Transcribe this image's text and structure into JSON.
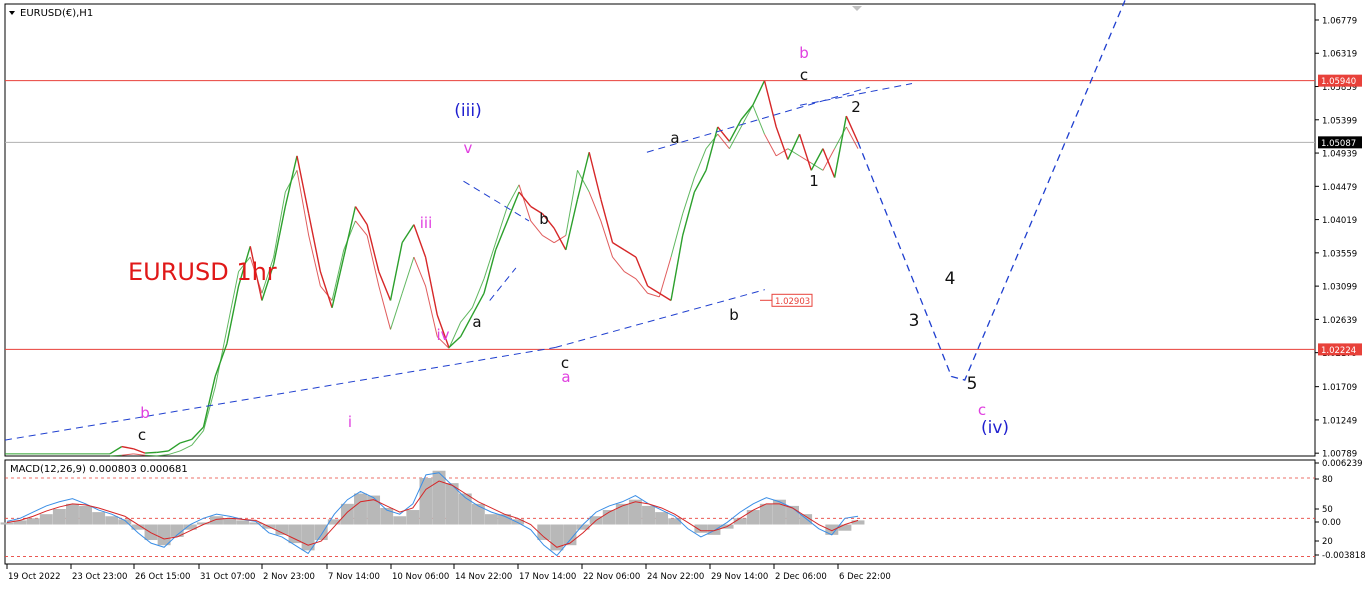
{
  "header": {
    "symbol_label": "EURUSD(€),H1",
    "indicator_label": "MACD(12,26,9) 0.000803 0.000681"
  },
  "colors": {
    "price_up": "#2ca02c",
    "price_down": "#d62728",
    "level_line": "#e8413a",
    "trend_line": "#1f3fcf",
    "wave_magenta": "#e040e0",
    "wave_blue": "#1f1fcf",
    "wave_black": "#111111",
    "title_red": "#e01818",
    "macd_hist": "#b8b8b8",
    "macd_line": "#3a8ee6",
    "signal_line": "#d62728"
  },
  "chart_data": [
    {
      "type": "line",
      "title": "EURUSD 1hr",
      "ylim": [
        1.0075,
        1.07
      ],
      "y_ticks": [
        "1.06779",
        "1.06319",
        "1.05859",
        "1.05399",
        "1.04939",
        "1.04479",
        "1.04019",
        "1.03559",
        "1.03099",
        "1.02639",
        "1.02179",
        "1.01709",
        "1.01249",
        "1.00789"
      ],
      "x_ticks": [
        "19 Oct 2022",
        "23 Oct 23:00",
        "26 Oct 15:00",
        "31 Oct 07:00",
        "2 Nov 23:00",
        "7 Nov 14:00",
        "10 Nov 06:00",
        "14 Nov 22:00",
        "17 Nov 14:00",
        "22 Nov 06:00",
        "24 Nov 22:00",
        "29 Nov 14:00",
        "2 Dec 06:00",
        "6 Dec 22:00"
      ],
      "horizontal_levels": [
        {
          "value": 1.0594,
          "label": "1.05940",
          "style": "red-box"
        },
        {
          "value": 1.05087,
          "label": "1.05087",
          "style": "dark-box"
        },
        {
          "value": 1.02224,
          "label": "1.02224",
          "style": "red-box"
        }
      ],
      "low_marker": {
        "value": 1.02903,
        "label": "1.02903"
      },
      "series": [
        {
          "values": [
            1.0078,
            1.0088,
            1.0085,
            1.0079,
            1.008,
            1.0082,
            1.0093,
            1.0098,
            1.0115,
            1.0185,
            1.023,
            1.031,
            1.0365,
            1.029,
            1.034,
            1.042,
            1.049,
            1.041,
            1.033,
            1.028,
            1.035,
            1.042,
            1.0395,
            1.033,
            1.029,
            1.037,
            1.0395,
            1.035,
            1.027,
            1.0225,
            1.024,
            1.027,
            1.03,
            1.036,
            1.04,
            1.044,
            1.042,
            1.041,
            1.039,
            1.036,
            1.043,
            1.0495,
            1.043,
            1.037,
            1.036,
            1.035,
            1.031,
            1.03,
            1.029,
            1.038,
            1.044,
            1.047,
            1.053,
            1.051,
            1.054,
            1.056,
            1.0594,
            1.053,
            1.0485,
            1.052,
            1.047,
            1.05,
            1.046,
            1.0545,
            1.0509
          ]
        },
        {
          "values": [
            1.0075,
            1.0076,
            1.0078,
            1.0076,
            1.0075,
            1.0077,
            1.0082,
            1.009,
            1.011,
            1.017,
            1.025,
            1.033,
            1.035,
            1.03,
            1.035,
            1.044,
            1.047,
            1.038,
            1.031,
            1.029,
            1.036,
            1.04,
            1.038,
            1.031,
            1.025,
            1.03,
            1.035,
            1.031,
            1.024,
            1.0224,
            1.026,
            1.028,
            1.032,
            1.037,
            1.042,
            1.045,
            1.04,
            1.038,
            1.037,
            1.038,
            1.047,
            1.044,
            1.04,
            1.035,
            1.033,
            1.032,
            1.03,
            1.0295,
            1.035,
            1.041,
            1.046,
            1.05,
            1.052,
            1.05,
            1.053,
            1.056,
            1.052,
            1.049,
            1.05,
            1.049,
            1.048,
            1.047,
            1.05,
            1.053,
            1.05
          ]
        }
      ],
      "projection": [
        {
          "x": 0.0,
          "y": 1.0509
        },
        {
          "x": 0.35,
          "y": 1.0185
        },
        {
          "x": 0.4,
          "y": 1.018
        },
        {
          "x": 1.0,
          "y": 1.0705
        }
      ],
      "trend_lines": [
        {
          "name": "lower-trend",
          "from": [
            0.0,
            1.0097
          ],
          "to": [
            0.42,
            1.0225
          ]
        },
        {
          "name": "lower-channel",
          "from": [
            0.42,
            1.0225
          ],
          "to": [
            0.58,
            1.0305
          ]
        },
        {
          "name": "upper-channel",
          "from": [
            0.49,
            1.0495
          ],
          "to": [
            0.66,
            1.0585
          ]
        },
        {
          "name": "triangle-top",
          "from": [
            0.35,
            1.0455
          ],
          "to": [
            0.4,
            1.04
          ]
        },
        {
          "name": "triangle-bottom",
          "from": [
            0.37,
            1.029
          ],
          "to": [
            0.39,
            1.0335
          ]
        }
      ],
      "annotations": [
        {
          "text": "EURUSD 1hr",
          "kind": "title"
        },
        {
          "text": "(iii)",
          "kind": "blue"
        },
        {
          "text": "v",
          "kind": "magenta"
        },
        {
          "text": "iii",
          "kind": "magenta"
        },
        {
          "text": "iv",
          "kind": "magenta"
        },
        {
          "text": "i",
          "kind": "magenta"
        },
        {
          "text": "b",
          "kind": "magenta"
        },
        {
          "text": "c",
          "kind": "black"
        },
        {
          "text": "a",
          "kind": "black"
        },
        {
          "text": "b",
          "kind": "black"
        },
        {
          "text": "c",
          "kind": "black"
        },
        {
          "text": "a",
          "kind": "magenta"
        },
        {
          "text": "a",
          "kind": "black"
        },
        {
          "text": "b",
          "kind": "black"
        },
        {
          "text": "b",
          "kind": "magenta"
        },
        {
          "text": "c",
          "kind": "black"
        },
        {
          "text": "1",
          "kind": "black"
        },
        {
          "text": "2",
          "kind": "black"
        },
        {
          "text": "3",
          "kind": "black"
        },
        {
          "text": "4",
          "kind": "black"
        },
        {
          "text": "5",
          "kind": "black"
        },
        {
          "text": "c",
          "kind": "magenta"
        },
        {
          "text": "(iv)",
          "kind": "blue"
        }
      ]
    },
    {
      "type": "area",
      "title": "MACD(12,26,9) 0.000803 0.000681",
      "ylim": [
        -0.003818,
        0.006239
      ],
      "y_ticks": [
        "0.006239",
        "80",
        "50",
        "0.00",
        "20",
        "-0.003818"
      ],
      "hist": [
        0.0002,
        0.0004,
        0.0006,
        0.001,
        0.0015,
        0.002,
        0.0018,
        0.0012,
        0.0008,
        0.0005,
        -0.0005,
        -0.0015,
        -0.002,
        -0.0012,
        -0.0005,
        0.0002,
        0.0008,
        0.0006,
        0.0004,
        0.0002,
        -0.0004,
        -0.001,
        -0.0018,
        -0.0025,
        -0.0015,
        0.0005,
        0.002,
        0.003,
        0.0028,
        0.0016,
        0.0008,
        0.0014,
        0.0045,
        0.0052,
        0.004,
        0.003,
        0.002,
        0.001,
        0.001,
        0.0005,
        0.0,
        -0.0015,
        -0.0025,
        -0.002,
        -0.0005,
        0.0008,
        0.0014,
        0.002,
        0.0024,
        0.0018,
        0.0012,
        0.0006,
        0.0,
        -0.0008,
        -0.001,
        -0.0004,
        0.0006,
        0.0014,
        0.002,
        0.0024,
        0.0018,
        0.001,
        0.0,
        -0.001,
        -0.0006,
        0.0004
      ],
      "macd": [
        0.0003,
        0.0006,
        0.0012,
        0.0018,
        0.0022,
        0.0025,
        0.002,
        0.0014,
        0.001,
        0.0004,
        -0.0008,
        -0.0018,
        -0.0022,
        -0.001,
        0.0,
        0.0006,
        0.001,
        0.0008,
        0.0005,
        0.0003,
        -0.0008,
        -0.0012,
        -0.002,
        -0.0028,
        -0.001,
        0.001,
        0.0024,
        0.0032,
        0.0026,
        0.0014,
        0.001,
        0.002,
        0.0048,
        0.005,
        0.0038,
        0.0026,
        0.0018,
        0.0012,
        0.0008,
        0.0002,
        -0.0005,
        -0.002,
        -0.003,
        -0.0015,
        0.0,
        0.0012,
        0.0018,
        0.0022,
        0.0028,
        0.002,
        0.0014,
        0.0008,
        -0.0004,
        -0.0012,
        -0.0006,
        0.0002,
        0.0012,
        0.002,
        0.0026,
        0.0022,
        0.0016,
        0.0006,
        -0.0004,
        -0.001,
        0.0006,
        0.0008
      ],
      "signal": [
        0.0002,
        0.0004,
        0.0008,
        0.0013,
        0.0017,
        0.002,
        0.0019,
        0.0016,
        0.0012,
        0.0008,
        0.0,
        -0.0008,
        -0.0014,
        -0.0012,
        -0.0006,
        0.0,
        0.0005,
        0.0006,
        0.0005,
        0.0004,
        -0.0002,
        -0.0008,
        -0.0014,
        -0.002,
        -0.0016,
        -0.0002,
        0.0012,
        0.0022,
        0.0024,
        0.0018,
        0.0012,
        0.0016,
        0.0034,
        0.0042,
        0.0038,
        0.003,
        0.0022,
        0.0016,
        0.001,
        0.0006,
        0.0,
        -0.0012,
        -0.0022,
        -0.0018,
        -0.0008,
        0.0004,
        0.0012,
        0.0018,
        0.0022,
        0.002,
        0.0016,
        0.001,
        0.0002,
        -0.0006,
        -0.0006,
        -0.0002,
        0.0006,
        0.0014,
        0.002,
        0.002,
        0.0016,
        0.0008,
        0.0,
        -0.0006,
        0.0,
        0.0004
      ]
    }
  ]
}
